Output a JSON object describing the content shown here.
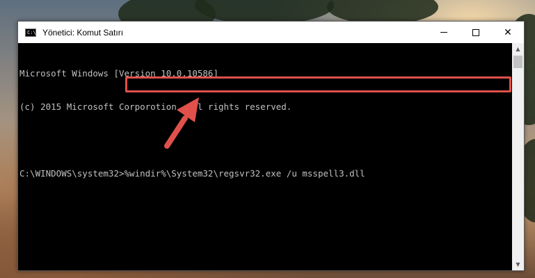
{
  "window": {
    "title": "Yönetici: Komut Satırı",
    "icon_label": "C:\\",
    "controls": {
      "minimize": "minimize",
      "maximize": "maximize",
      "close": "✕"
    }
  },
  "console": {
    "lines": [
      "Microsoft Windows [Version 10.0.10586]",
      "(c) 2015 Microsoft Corporotion. All rights reserved.",
      "",
      "C:\\WINDOWS\\system32>%windir%\\System32\\regsvr32.exe /u msspell3.dll"
    ]
  },
  "annotation": {
    "highlight_color": "#e0514b",
    "arrow_color": "#e0514b"
  }
}
